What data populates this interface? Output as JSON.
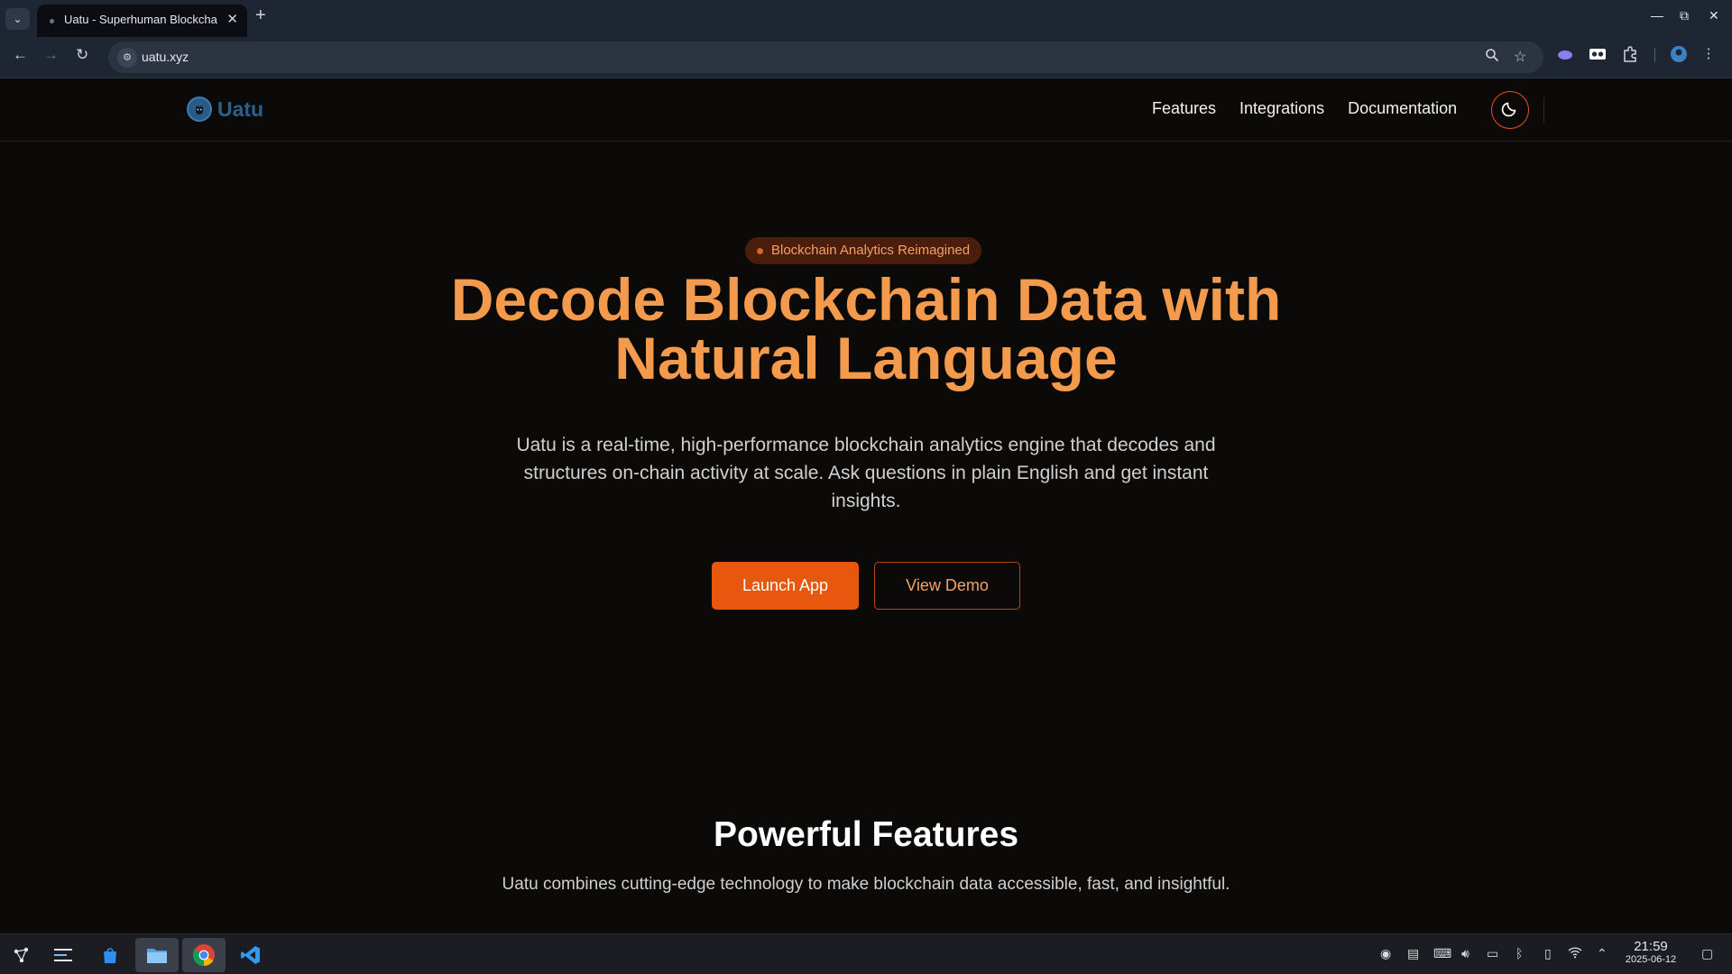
{
  "browser": {
    "tab_title": "Uatu - Superhuman Blockchain",
    "tab_close": "✕",
    "new_tab": "+",
    "url": "uatu.xyz",
    "window_controls": {
      "minimize": "—",
      "maximize": "⧉",
      "close": "✕"
    }
  },
  "site": {
    "brand": "Uatu",
    "nav": [
      "Features",
      "Integrations",
      "Documentation"
    ],
    "theme_toggle_icon": "moon-icon",
    "accent_color": "#e8570e"
  },
  "hero": {
    "badge": "Blockchain Analytics Reimagined",
    "title_line1": "Decode Blockchain Data with",
    "title_line2": "Natural Language",
    "subtitle": "Uatu is a real-time, high-performance blockchain analytics engine that decodes and structures on-chain activity at scale. Ask questions in plain English and get instant insights.",
    "primary_cta": "Launch App",
    "secondary_cta": "View Demo"
  },
  "features": {
    "title": "Powerful Features",
    "subtitle": "Uatu combines cutting-edge technology to make blockchain data accessible, fast, and insightful."
  },
  "taskbar": {
    "time": "21:59",
    "date": "2025-06-12"
  }
}
